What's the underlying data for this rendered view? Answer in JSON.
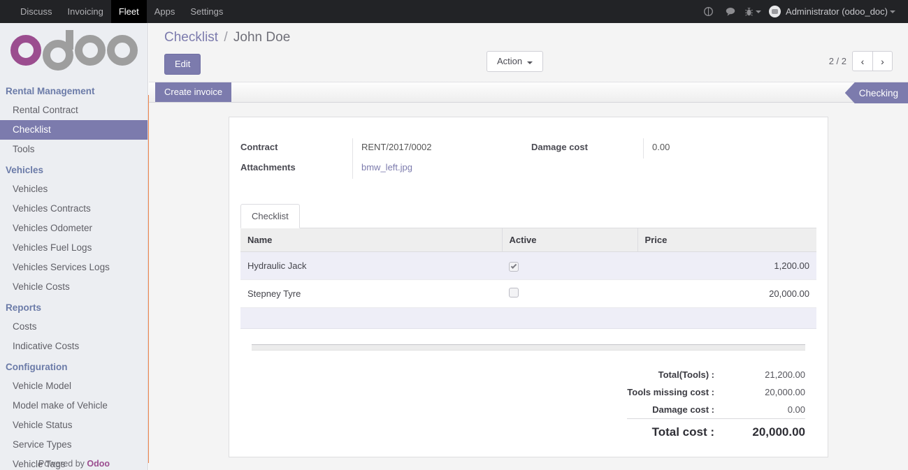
{
  "navbar": {
    "menu_items": [
      {
        "label": "Discuss",
        "active": false
      },
      {
        "label": "Invoicing",
        "active": false
      },
      {
        "label": "Fleet",
        "active": true
      },
      {
        "label": "Apps",
        "active": false
      },
      {
        "label": "Settings",
        "active": false
      }
    ],
    "icons": [
      {
        "name": "activity-icon",
        "glyph": "◔"
      },
      {
        "name": "messages-icon",
        "glyph": "☁"
      },
      {
        "name": "debug-bug-icon",
        "glyph": "⚙"
      }
    ],
    "user": "Administrator (odoo_doc)"
  },
  "sidebar": {
    "logo_alt": "odoo",
    "sections": [
      {
        "title": "Rental Management",
        "items": [
          {
            "label": "Rental Contract",
            "active": false
          },
          {
            "label": "Checklist",
            "active": true
          },
          {
            "label": "Tools",
            "active": false
          }
        ]
      },
      {
        "title": "Vehicles",
        "items": [
          {
            "label": "Vehicles",
            "active": false
          },
          {
            "label": "Vehicles Contracts",
            "active": false
          },
          {
            "label": "Vehicles Odometer",
            "active": false
          },
          {
            "label": "Vehicles Fuel Logs",
            "active": false
          },
          {
            "label": "Vehicles Services Logs",
            "active": false
          },
          {
            "label": "Vehicle Costs",
            "active": false
          }
        ]
      },
      {
        "title": "Reports",
        "items": [
          {
            "label": "Costs",
            "active": false
          },
          {
            "label": "Indicative Costs",
            "active": false
          }
        ]
      },
      {
        "title": "Configuration",
        "items": [
          {
            "label": "Vehicle Model",
            "active": false
          },
          {
            "label": "Model make of Vehicle",
            "active": false
          },
          {
            "label": "Vehicle Status",
            "active": false
          },
          {
            "label": "Service Types",
            "active": false
          },
          {
            "label": "Vehicle Tags",
            "active": false
          }
        ]
      }
    ],
    "footer_prefix": "Powered by",
    "footer_brand": "Odoo"
  },
  "control_panel": {
    "breadcrumb_root": "Checklist",
    "breadcrumb_sep": "/",
    "breadcrumb_current": "John Doe",
    "edit_label": "Edit",
    "action_label": "Action",
    "pager_text": "2 / 2",
    "prev_glyph": "‹",
    "next_glyph": "›"
  },
  "statusbar": {
    "create_invoice_label": "Create invoice",
    "status_label": "Checking"
  },
  "form": {
    "fields": [
      {
        "label": "Contract",
        "value": "RENT/2017/0002",
        "link": false
      },
      {
        "label": "Attachments",
        "value": "bmw_left.jpg",
        "link": true
      }
    ],
    "damage_cost_label": "Damage cost",
    "damage_cost_value": "0.00"
  },
  "notebook": {
    "tab_label": "Checklist",
    "columns": [
      "Name",
      "Active",
      "Price"
    ],
    "rows": [
      {
        "name": "Hydraulic Jack",
        "active": true,
        "price": "1,200.00"
      },
      {
        "name": "Stepney Tyre",
        "active": false,
        "price": "20,000.00"
      }
    ]
  },
  "totals": {
    "rows": [
      {
        "label": "Total(Tools) :",
        "value": "21,200.00"
      },
      {
        "label": "Tools missing cost :",
        "value": "20,000.00"
      },
      {
        "label": "Damage cost :",
        "value": "0.00"
      }
    ],
    "grand_label": "Total cost :",
    "grand_value": "20,000.00"
  },
  "colors": {
    "brand_purple": "#7c7bad",
    "logo_magenta": "#9b4d8f",
    "accent_orange": "#f0874f",
    "navbar_bg": "#222326"
  }
}
